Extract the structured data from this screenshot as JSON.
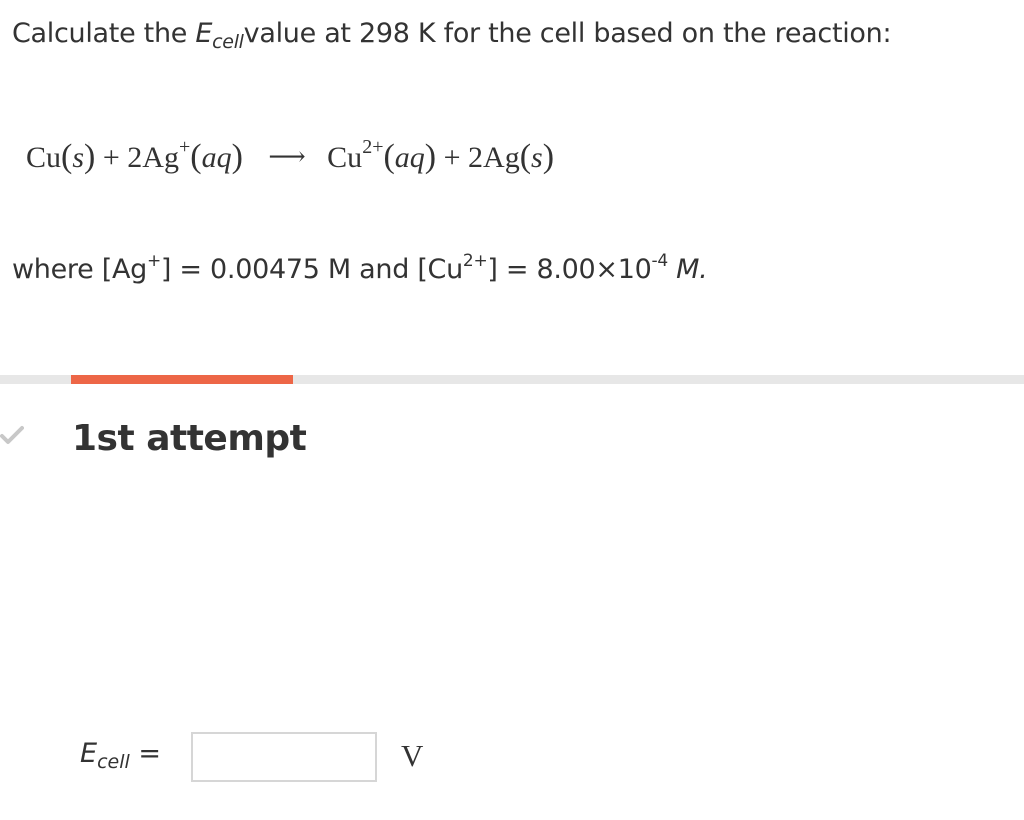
{
  "question": {
    "prefix": "Calculate the ",
    "symbol_E": "E",
    "symbol_sub": "cell",
    "suffix": "value at 298 K for the cell based on the reaction:"
  },
  "reaction": {
    "reactant1": "Cu",
    "reactant1_state": "s",
    "plus1": "+",
    "reactant2": "2Ag",
    "reactant2_charge": "+",
    "reactant2_state": "aq",
    "arrow": "⟶",
    "product1": "Cu",
    "product1_charge": "2+",
    "product1_state": "aq",
    "plus2": "+",
    "product2": "2Ag",
    "product2_state": "s"
  },
  "conditions": {
    "text1": "where [Ag",
    "ag_charge": "+",
    "text2": "] = 0.00475 M and [Cu",
    "cu_charge": "2+",
    "text3": "] = 8.00×10",
    "exponent": "-4",
    "unit": " M."
  },
  "attempt": {
    "title": "1st attempt",
    "check_icon": "checkmark-icon"
  },
  "answer": {
    "label_E": "E",
    "label_sub": "cell",
    "equals": " =",
    "value": "",
    "unit": "V"
  },
  "colors": {
    "progress_active": "#ed6647",
    "progress_track": "#e7e7e7",
    "text": "#333333",
    "check": "#c8c8c8"
  }
}
